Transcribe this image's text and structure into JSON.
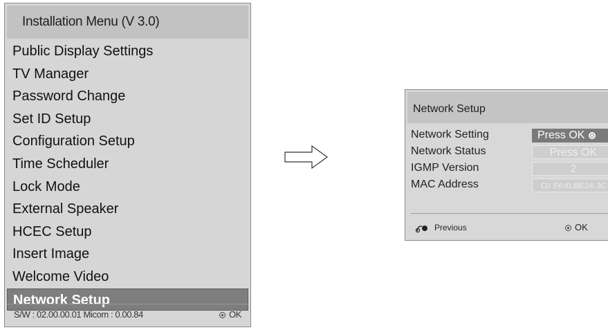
{
  "install_menu": {
    "title": "Installation Menu (V 3.0)",
    "items": [
      "Public Display Settings",
      "TV Manager",
      "Password Change",
      "Set ID Setup",
      "Configuration Setup",
      "Time Scheduler",
      "Lock Mode",
      "External Speaker",
      "HCEC Setup",
      "Insert Image",
      "Welcome Video",
      "Network Setup"
    ],
    "selected": "Network Setup",
    "footer_info": "S/W : 02.00.00.01 Micom : 0.00.84",
    "footer_ok": "OK"
  },
  "network_dialog": {
    "title": "Network Setup",
    "rows": [
      {
        "label": "Network Setting",
        "value": "Press OK"
      },
      {
        "label": "Network Status",
        "value": "Press OK"
      },
      {
        "label": "IGMP Version",
        "value": "2"
      },
      {
        "label": "MAC Address",
        "value": "C0 :F6:41:BE:24: 3C"
      }
    ],
    "footer_previous": "Previous",
    "footer_ok": "OK"
  },
  "colors": {
    "menu_bg": "#d6d6d6",
    "title_bg": "#c2c2c2",
    "selected_bg": "#7e7e7e"
  }
}
